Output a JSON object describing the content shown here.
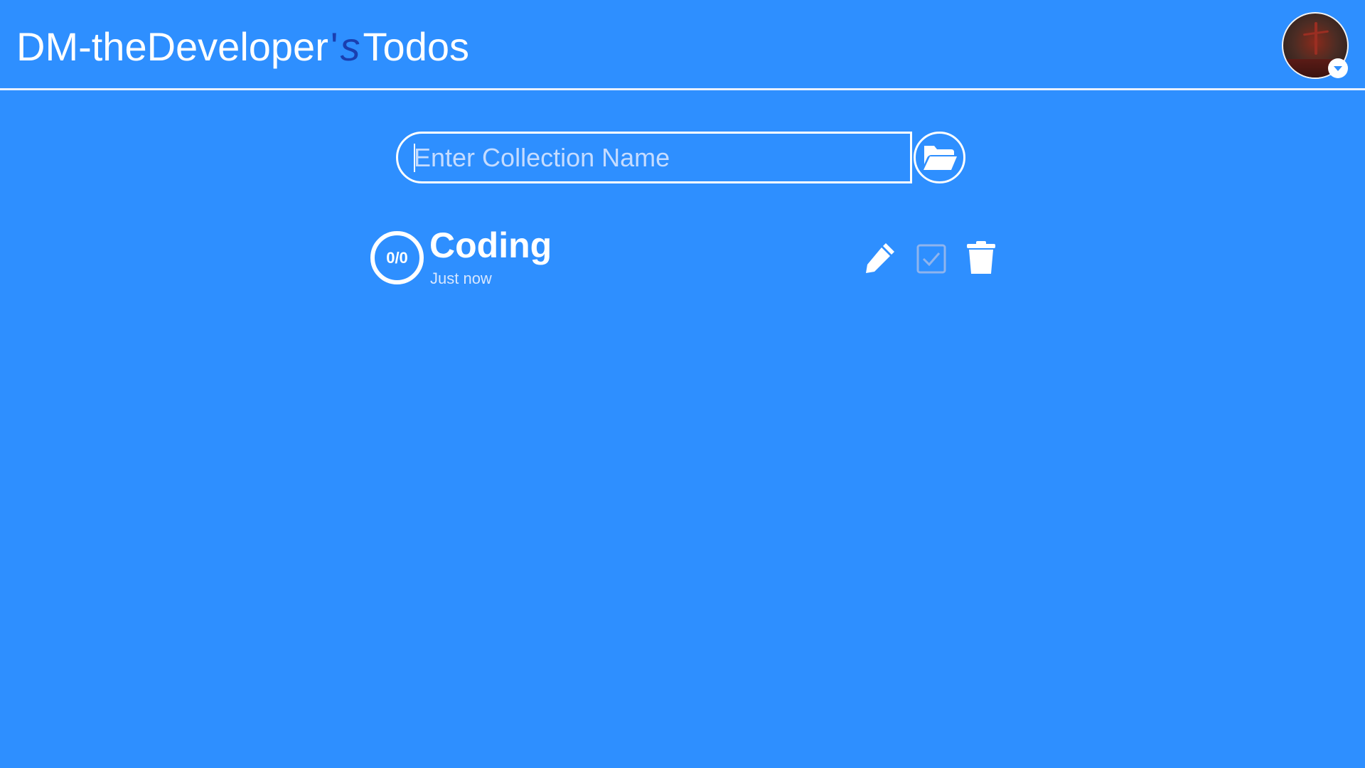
{
  "header": {
    "brand_name": "DM-theDeveloper",
    "brand_apostrophe": "'",
    "brand_s": "s",
    "brand_suffix": "Todos",
    "avatar_icon": "user-avatar-image",
    "avatar_menu_icon": "caret-down-icon"
  },
  "search": {
    "placeholder": "Enter Collection Name",
    "value": "",
    "submit_icon": "folder-open-icon"
  },
  "collections": [
    {
      "title": "Coding",
      "time": "Just now",
      "progress": "0/0",
      "actions": [
        "pencil-icon",
        "checkbox-icon",
        "trash-icon"
      ]
    }
  ],
  "colors": {
    "background": "#2e8fff",
    "accent_text": "#1a3fb0",
    "foreground": "#ffffff",
    "muted_icon": "#8fb4ee"
  }
}
